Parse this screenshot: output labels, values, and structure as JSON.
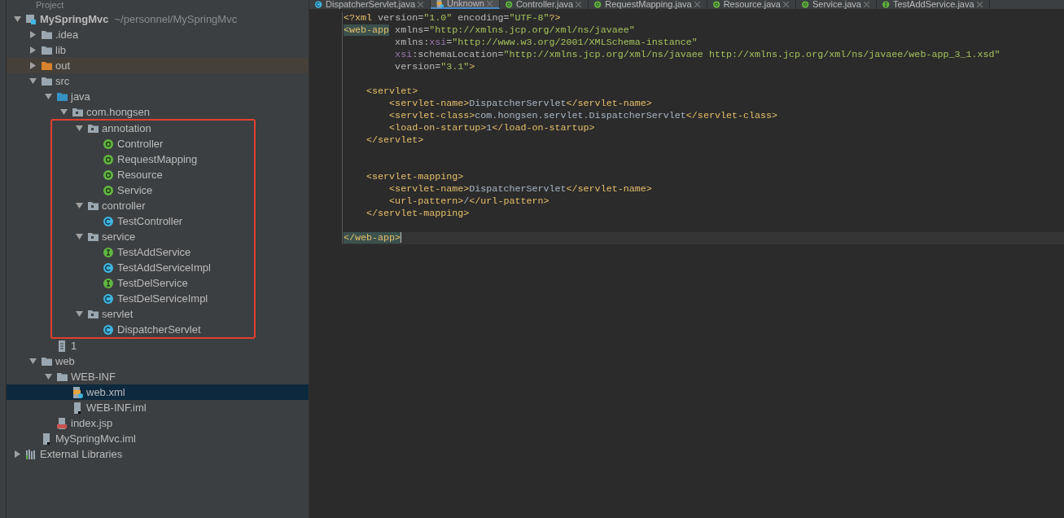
{
  "project_panel": {
    "title": "Project",
    "tree": [
      {
        "label": "MySpringMvc",
        "path": "~/personnel/MySpringMvc",
        "kind": "module",
        "expanded": true,
        "selected": false,
        "children": [
          {
            "label": ".idea",
            "kind": "folder",
            "expanded": false,
            "selected": false
          },
          {
            "label": "lib",
            "kind": "folder",
            "expanded": false,
            "selected": false
          },
          {
            "label": "out",
            "kind": "excluded_folder",
            "expanded": false,
            "selected": false
          },
          {
            "label": "src",
            "kind": "folder",
            "expanded": true,
            "selected": false,
            "children": [
              {
                "label": "java",
                "kind": "source_folder",
                "expanded": true,
                "selected": false,
                "children": [
                  {
                    "label": "com.hongsen",
                    "kind": "package",
                    "expanded": true,
                    "selected": false,
                    "framed_children": true,
                    "children": [
                      {
                        "label": "annotation",
                        "kind": "package",
                        "expanded": true,
                        "selected": false,
                        "children": [
                          {
                            "label": "Controller",
                            "kind": "annotation",
                            "selected": false
                          },
                          {
                            "label": "RequestMapping",
                            "kind": "annotation",
                            "selected": false
                          },
                          {
                            "label": "Resource",
                            "kind": "annotation",
                            "selected": false
                          },
                          {
                            "label": "Service",
                            "kind": "annotation",
                            "selected": false
                          }
                        ]
                      },
                      {
                        "label": "controller",
                        "kind": "package",
                        "expanded": true,
                        "selected": false,
                        "children": [
                          {
                            "label": "TestController",
                            "kind": "class",
                            "selected": false
                          }
                        ]
                      },
                      {
                        "label": "service",
                        "kind": "package",
                        "expanded": true,
                        "selected": false,
                        "children": [
                          {
                            "label": "TestAddService",
                            "kind": "interface",
                            "selected": false
                          },
                          {
                            "label": "TestAddServiceImpl",
                            "kind": "class",
                            "selected": false
                          },
                          {
                            "label": "TestDelService",
                            "kind": "interface",
                            "selected": false
                          },
                          {
                            "label": "TestDelServiceImpl",
                            "kind": "class",
                            "selected": false
                          }
                        ]
                      },
                      {
                        "label": "servlet",
                        "kind": "package",
                        "expanded": true,
                        "selected": false,
                        "children": [
                          {
                            "label": "DispatcherServlet",
                            "kind": "class",
                            "selected": false
                          }
                        ]
                      }
                    ]
                  }
                ]
              },
              {
                "label": "1",
                "kind": "text_file",
                "selected": false
              }
            ]
          },
          {
            "label": "web",
            "kind": "folder",
            "expanded": true,
            "selected": false,
            "children": [
              {
                "label": "WEB-INF",
                "kind": "folder",
                "expanded": true,
                "selected": false,
                "children": [
                  {
                    "label": "web.xml",
                    "kind": "xml",
                    "selected": true
                  },
                  {
                    "label": "WEB-INF.iml",
                    "kind": "iml",
                    "selected": false
                  }
                ]
              },
              {
                "label": "index.jsp",
                "kind": "jsp",
                "selected": false
              }
            ]
          },
          {
            "label": "MySpringMvc.iml",
            "kind": "iml",
            "selected": false
          }
        ]
      },
      {
        "label": "External Libraries",
        "kind": "libraries",
        "expanded": false,
        "selected": false
      }
    ]
  },
  "editor": {
    "tabs": [
      {
        "label": "DispatcherServlet.java",
        "kind": "class",
        "selected": false
      },
      {
        "label": "Unknown",
        "kind": "xml",
        "selected": true
      },
      {
        "label": "Controller.java",
        "kind": "annotation",
        "selected": false
      },
      {
        "label": "RequestMapping.java",
        "kind": "annotation",
        "selected": false
      },
      {
        "label": "Resource.java",
        "kind": "annotation",
        "selected": false
      },
      {
        "label": "Service.java",
        "kind": "annotation",
        "selected": false
      },
      {
        "label": "TestAddService.java",
        "kind": "interface",
        "selected": false
      }
    ],
    "lines": [
      {
        "current": false,
        "tokens": [
          {
            "kind": "tag",
            "text": "<?xml "
          },
          {
            "kind": "attr",
            "text": "version="
          },
          {
            "kind": "value",
            "text": "\"1.0\" "
          },
          {
            "kind": "attr",
            "text": "encoding="
          },
          {
            "kind": "value",
            "text": "\"UTF-8\""
          },
          {
            "kind": "tag",
            "text": "?>"
          }
        ]
      },
      {
        "current": false,
        "tokens": [
          {
            "kind": "tag_match",
            "text": "<web-app"
          },
          {
            "kind": "attr",
            "text": " xmlns="
          },
          {
            "kind": "value",
            "text": "\"http://xmlns.jcp.org/xml/ns/javaee\""
          }
        ]
      },
      {
        "current": false,
        "tokens": [
          {
            "kind": "attr",
            "text": "         xmlns:"
          },
          {
            "kind": "ns",
            "text": "xsi"
          },
          {
            "kind": "attr",
            "text": "="
          },
          {
            "kind": "value",
            "text": "\"http://www.w3.org/2001/XMLSchema-instance\""
          }
        ]
      },
      {
        "current": false,
        "tokens": [
          {
            "kind": "ns",
            "text": "         xsi"
          },
          {
            "kind": "attr",
            "text": ":schemaLocation="
          },
          {
            "kind": "value",
            "text": "\"http://xmlns.jcp.org/xml/ns/javaee http://xmlns.jcp.org/xml/ns/javaee/web-app_3_1.xsd\""
          }
        ]
      },
      {
        "current": false,
        "tokens": [
          {
            "kind": "attr",
            "text": "         version="
          },
          {
            "kind": "value",
            "text": "\"3.1\""
          },
          {
            "kind": "tag",
            "text": ">"
          }
        ]
      },
      {
        "current": false
      },
      {
        "current": false,
        "tokens": [
          {
            "kind": "tag",
            "text": "    <servlet>"
          }
        ]
      },
      {
        "current": false,
        "tokens": [
          {
            "kind": "tag",
            "text": "        <servlet-name>"
          },
          {
            "kind": "text",
            "text": "DispatcherServlet"
          },
          {
            "kind": "tag",
            "text": "</servlet-name>"
          }
        ]
      },
      {
        "current": false,
        "tokens": [
          {
            "kind": "tag",
            "text": "        <servlet-class>"
          },
          {
            "kind": "text",
            "text": "com.hongsen.servlet.DispatcherServlet"
          },
          {
            "kind": "tag",
            "text": "</servlet-class>"
          }
        ]
      },
      {
        "current": false,
        "tokens": [
          {
            "kind": "tag",
            "text": "        <load-on-startup>"
          },
          {
            "kind": "text",
            "text": "1"
          },
          {
            "kind": "tag",
            "text": "</load-on-startup>"
          }
        ]
      },
      {
        "current": false,
        "tokens": [
          {
            "kind": "tag",
            "text": "    </servlet>"
          }
        ]
      },
      {
        "current": false
      },
      {
        "current": false
      },
      {
        "current": false,
        "tokens": [
          {
            "kind": "tag",
            "text": "    <servlet-mapping>"
          }
        ]
      },
      {
        "current": false,
        "tokens": [
          {
            "kind": "tag",
            "text": "        <servlet-name>"
          },
          {
            "kind": "text",
            "text": "DispatcherServlet"
          },
          {
            "kind": "tag",
            "text": "</servlet-name>"
          }
        ]
      },
      {
        "current": false,
        "tokens": [
          {
            "kind": "tag",
            "text": "        <url-pattern>"
          },
          {
            "kind": "text",
            "text": "/"
          },
          {
            "kind": "tag",
            "text": "</url-pattern>"
          }
        ]
      },
      {
        "current": false,
        "tokens": [
          {
            "kind": "tag",
            "text": "    </servlet-mapping>"
          }
        ]
      },
      {
        "current": false
      },
      {
        "current": true,
        "tokens": [
          {
            "kind": "tag_match",
            "text": "</web-app>"
          }
        ]
      }
    ]
  }
}
